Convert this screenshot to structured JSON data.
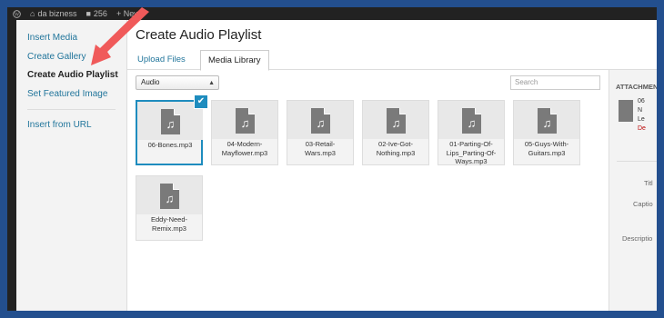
{
  "adminbar": {
    "site_name": "da bizness",
    "comments_count": "256",
    "new_label": "+ New"
  },
  "menu": {
    "items": [
      "Insert Media",
      "Create Gallery",
      "Create Audio Playlist",
      "Set Featured Image"
    ],
    "insert_url": "Insert from URL",
    "active_index": 2
  },
  "title": "Create Audio Playlist",
  "tabs": [
    "Upload Files",
    "Media Library"
  ],
  "filter": {
    "selected": "Audio"
  },
  "search": {
    "placeholder": "Search"
  },
  "files": [
    {
      "name": "06-Bones.mp3",
      "selected": true
    },
    {
      "name": "04-Modern-Mayflower.mp3",
      "selected": false
    },
    {
      "name": "03-Retail-Wars.mp3",
      "selected": false
    },
    {
      "name": "02-Ive-Got-Nothing.mp3",
      "selected": false
    },
    {
      "name": "01-Parting-Of-Lips_Parting-Of-Ways.mp3",
      "selected": false
    },
    {
      "name": "05-Guys-With-Guitars.mp3",
      "selected": false
    },
    {
      "name": "Eddy-Need-Remix.mp3",
      "selected": false
    }
  ],
  "details": {
    "heading": "ATTACHMENT",
    "lines": [
      "06",
      "N",
      "Le",
      "De"
    ],
    "fields": [
      "Titl",
      "Captio",
      "Descriptio"
    ]
  },
  "colors": {
    "frame": "#234f8e",
    "accent": "#1e8cbe",
    "link": "#21759b",
    "arrow": "#f05a5a"
  }
}
